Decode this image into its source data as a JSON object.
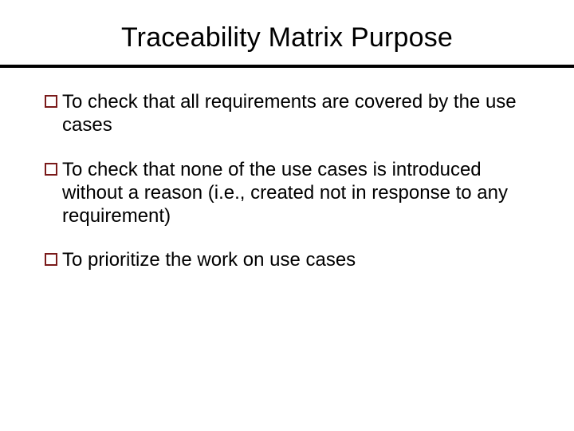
{
  "title": "Traceability Matrix Purpose",
  "bullets": [
    {
      "text": "To check that all requirements are covered by the use cases"
    },
    {
      "text": "To check that none of the use cases is introduced without a reason (i.e., created not in response to any requirement)"
    },
    {
      "text": "To prioritize the work on use cases"
    }
  ]
}
